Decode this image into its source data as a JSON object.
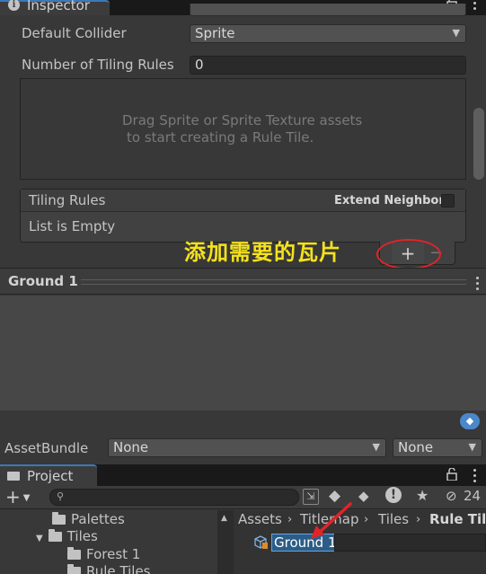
{
  "inspector": {
    "tab_title": "Inspector",
    "default_collider_label": "Default Collider",
    "default_collider_value": "Sprite",
    "num_tiling_rules_label": "Number of Tiling Rules",
    "num_tiling_rules_value": "0",
    "drop_hint_line1": "Drag Sprite or Sprite Texture assets",
    "drop_hint_line2": "to start creating a Rule Tile.",
    "tiling_rules_label": "Tiling Rules",
    "extend_neighbor_label": "Extend Neighbor",
    "list_empty": "List is Empty",
    "add_symbol": "+",
    "remove_symbol": "−",
    "annotation_text": "添加需要的瓦片"
  },
  "preview": {
    "title": "Ground 1"
  },
  "asset_bundle": {
    "label": "AssetBundle",
    "name_value": "None",
    "variant_value": "None"
  },
  "project": {
    "tab_title": "Project",
    "add_symbol": "+",
    "hidden_count": "24",
    "tree": [
      {
        "label": "Palettes"
      },
      {
        "label": "Tiles"
      },
      {
        "label": "Forest 1"
      },
      {
        "label": "Rule Tiles"
      }
    ],
    "breadcrumb": [
      "Assets",
      "Titlemap",
      "Tiles",
      "Rule Tile"
    ],
    "selected_asset": "Ground 1"
  },
  "colors": {
    "accent": "#3a79bb",
    "annotation": "#f5e21c",
    "highlight": "#e0242a",
    "selection": "#2c5d87"
  }
}
